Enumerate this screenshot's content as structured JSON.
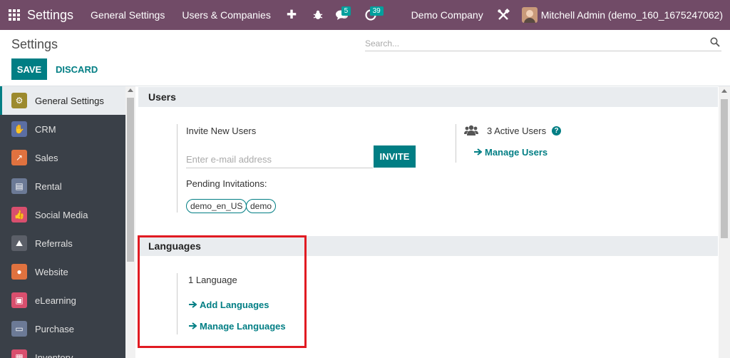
{
  "navbar": {
    "app_title": "Settings",
    "menus": [
      "General Settings",
      "Users & Companies"
    ],
    "plus": "✚",
    "messages_count": "5",
    "activities_count": "39",
    "company": "Demo Company",
    "user": "Mitchell Admin (demo_160_1675247062)"
  },
  "control_panel": {
    "breadcrumb": "Settings",
    "search_placeholder": "Search...",
    "save_label": "SAVE",
    "discard_label": "DISCARD"
  },
  "sidebar": {
    "items": [
      {
        "label": "General Settings",
        "icon": "gear-icon",
        "color": "#9c8a2e",
        "active": true
      },
      {
        "label": "CRM",
        "icon": "handshake-icon",
        "color": "#5b6ea3"
      },
      {
        "label": "Sales",
        "icon": "sales-chart-icon",
        "color": "#e0723f"
      },
      {
        "label": "Rental",
        "icon": "rental-icon",
        "color": "#6c7a96"
      },
      {
        "label": "Social Media",
        "icon": "thumbs-up-icon",
        "color": "#d94f6e"
      },
      {
        "label": "Referrals",
        "icon": "referrals-icon",
        "color": "#5b5f68"
      },
      {
        "label": "Website",
        "icon": "globe-icon",
        "color": "#e0723f"
      },
      {
        "label": "eLearning",
        "icon": "elearning-icon",
        "color": "#d94f6e"
      },
      {
        "label": "Purchase",
        "icon": "purchase-card-icon",
        "color": "#6c7a96"
      },
      {
        "label": "Inventory",
        "icon": "inventory-icon",
        "color": "#d94f6e"
      }
    ]
  },
  "users_section": {
    "title": "Users",
    "invite_label": "Invite New Users",
    "email_placeholder": "Enter e-mail address",
    "invite_button": "INVITE",
    "pending_label": "Pending Invitations:",
    "pending_tags": [
      "demo_en_US",
      "demo"
    ],
    "active_users": "3 Active Users",
    "manage_users": "Manage Users"
  },
  "languages_section": {
    "title": "Languages",
    "count": "1 Language",
    "add_languages": "Add Languages",
    "manage_languages": "Manage Languages"
  },
  "colors": {
    "navbar": "#714b67",
    "accent": "#017e84",
    "highlight": "#e11b22"
  }
}
